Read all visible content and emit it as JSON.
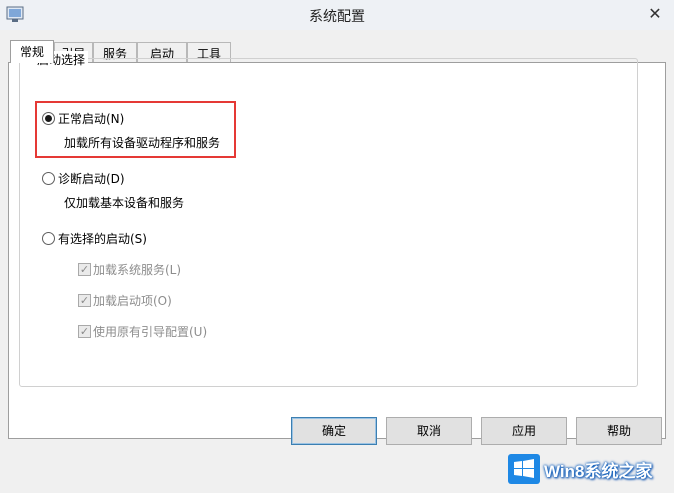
{
  "window": {
    "title": "系统配置"
  },
  "tabs": [
    {
      "label": "常规",
      "active": true
    },
    {
      "label": "引导",
      "active": false
    },
    {
      "label": "服务",
      "active": false
    },
    {
      "label": "启动",
      "active": false
    },
    {
      "label": "工具",
      "active": false
    }
  ],
  "startup_selection": {
    "group_title": "启动选择",
    "options": [
      {
        "label": "正常启动(N)",
        "description": "加载所有设备驱动程序和服务",
        "checked": true
      },
      {
        "label": "诊断启动(D)",
        "description": "仅加载基本设备和服务",
        "checked": false
      },
      {
        "label": "有选择的启动(S)",
        "checked": false
      }
    ],
    "selective_items": [
      {
        "label": "加载系统服务(L)",
        "checked": true,
        "enabled": false
      },
      {
        "label": "加载启动项(O)",
        "checked": true,
        "enabled": false
      },
      {
        "label": "使用原有引导配置(U)",
        "checked": true,
        "enabled": false
      }
    ]
  },
  "buttons": {
    "ok": "确定",
    "cancel": "取消",
    "apply": "应用",
    "help": "帮助"
  },
  "watermark": {
    "text": "Win8系统之家"
  },
  "colors": {
    "highlight_box": "#e53935",
    "watermark_blue": "#1565c0"
  }
}
